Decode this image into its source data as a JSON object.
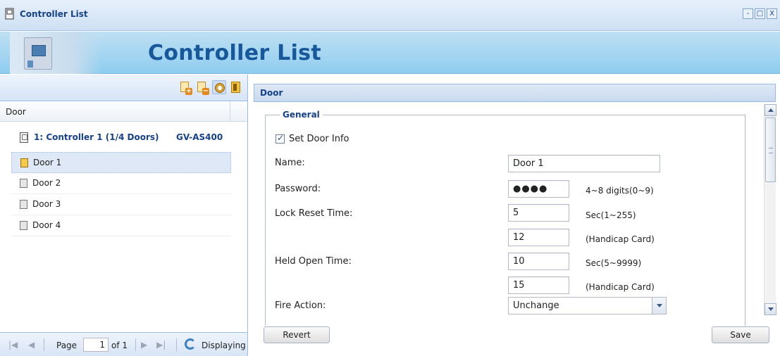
{
  "window": {
    "title": "Controller List",
    "controls": [
      "-",
      "□",
      "X"
    ]
  },
  "banner": {
    "title": "Controller List"
  },
  "left_panel": {
    "toolbar_buttons": [
      "add-controller",
      "remove-controller",
      "settings",
      "door"
    ],
    "column_header": "Door",
    "controller": {
      "label": "1: Controller 1 (1/4 Doors)",
      "model": "GV-AS400"
    },
    "doors": [
      {
        "label": "Door 1",
        "selected": true
      },
      {
        "label": "Door 2",
        "selected": false
      },
      {
        "label": "Door 3",
        "selected": false
      },
      {
        "label": "Door 4",
        "selected": false
      }
    ],
    "pager": {
      "page_label": "Page",
      "page_value": "1",
      "of_label": "of 1",
      "displaying": "Displaying"
    }
  },
  "right_panel": {
    "title": "Door",
    "section": "General",
    "set_door_info": {
      "label": "Set Door Info",
      "checked": true
    },
    "fields": {
      "name": {
        "label": "Name:",
        "value": "Door 1"
      },
      "password": {
        "label": "Password:",
        "value": "●●●●",
        "hint": "4~8 digits(0~9)"
      },
      "lock_reset": {
        "label": "Lock Reset Time:",
        "value": "5",
        "hint": "Sec(1~255)",
        "handicap_value": "12",
        "handicap_hint": "(Handicap Card)"
      },
      "held_open": {
        "label": "Held Open Time:",
        "value": "10",
        "hint": "Sec(5~9999)",
        "handicap_value": "15",
        "handicap_hint": "(Handicap Card)"
      },
      "fire_action": {
        "label": "Fire Action:",
        "value": "Unchange"
      }
    },
    "buttons": {
      "revert": "Revert",
      "save": "Save"
    }
  }
}
